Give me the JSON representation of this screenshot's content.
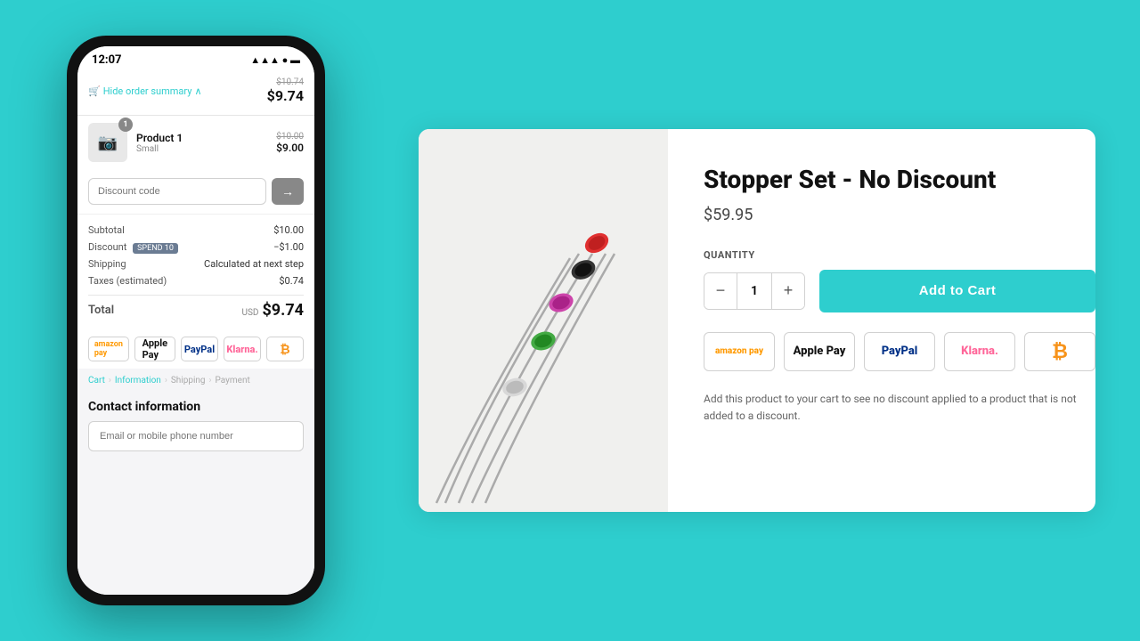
{
  "phone": {
    "status_time": "12:07",
    "order_summary": {
      "hide_label": "Hide order summary",
      "price_strikethrough": "$10.74",
      "price_main": "$9.74"
    },
    "product": {
      "name": "Product 1",
      "variant": "Small",
      "price_old": "$10.00",
      "price_new": "$9.00",
      "badge": "1"
    },
    "discount": {
      "placeholder": "Discount code",
      "arrow": "→"
    },
    "totals": {
      "subtotal_label": "Subtotal",
      "subtotal_value": "$10.00",
      "discount_label": "Discount",
      "discount_code": "SPEND 10",
      "discount_value": "−$1.00",
      "shipping_label": "Shipping",
      "shipping_value": "Calculated at next step",
      "taxes_label": "Taxes (estimated)",
      "taxes_value": "$0.74",
      "total_label": "Total",
      "total_currency": "USD",
      "total_amount": "$9.74"
    },
    "payment_icons": [
      {
        "label": "amazon pay",
        "type": "amazon"
      },
      {
        "label": "Apple Pay",
        "type": "apple"
      },
      {
        "label": "PayPal",
        "type": "paypal"
      },
      {
        "label": "Klarna.",
        "type": "klarna"
      },
      {
        "label": "₿",
        "type": "btc"
      }
    ],
    "breadcrumb": {
      "items": [
        "Cart",
        "Information",
        "Shipping",
        "Payment"
      ]
    },
    "contact": {
      "title": "Contact information",
      "placeholder": "Email or mobile phone number"
    }
  },
  "product_card": {
    "title": "Stopper Set - No Discount",
    "price": "$59.95",
    "quantity_label": "QUANTITY",
    "quantity_value": 1,
    "add_to_cart_label": "Add to Cart",
    "payment_methods": [
      {
        "label": "amazon pay",
        "type": "amazon"
      },
      {
        "label": "Apple Pay",
        "type": "apple"
      },
      {
        "label": "PayPal",
        "type": "paypal"
      },
      {
        "label": "Klarna.",
        "type": "klarna"
      },
      {
        "label": "₿",
        "type": "btc"
      }
    ],
    "description": "Add this product to your cart to see no discount applied to a product that is not added to a discount."
  }
}
